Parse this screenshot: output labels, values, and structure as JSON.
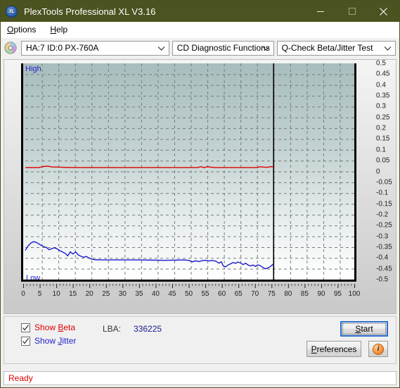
{
  "window": {
    "title": "PlexTools Professional XL V3.16",
    "icon": "xl-app-icon",
    "minimize": "minimize-icon",
    "maximize": "maximize-icon",
    "close": "close-icon"
  },
  "menu": {
    "items": [
      {
        "label": "Options",
        "accel": "O"
      },
      {
        "label": "Help",
        "accel": "H"
      }
    ]
  },
  "toolbar": {
    "drive_icon": "optical-disc-icon",
    "drive_select": {
      "value": "HA:7 ID:0  PX-760A"
    },
    "function_select": {
      "value": "CD Diagnostic Functions"
    },
    "test_select": {
      "value": "Q-Check Beta/Jitter Test"
    }
  },
  "chart_labels": {
    "high": "High",
    "low": "Low"
  },
  "controls": {
    "show_beta": {
      "label": "Show Beta",
      "checked": true,
      "color": "#e00000"
    },
    "show_jitter": {
      "label": "Show Jitter",
      "checked": true,
      "color": "#2222cc"
    },
    "lba_label": "LBA:",
    "lba_value": "336225",
    "start_label": "Start",
    "preferences_label": "Preferences",
    "info_icon": "info-icon"
  },
  "status": {
    "text": "Ready"
  },
  "colors": {
    "titlebar": "#4b5320",
    "beta_line": "#e00000",
    "jitter_line": "#1a1ad0",
    "accent_focus": "#2a6fd0"
  },
  "chart_data": {
    "type": "line",
    "title": "Q-Check Beta/Jitter Test",
    "xlabel": "",
    "ylabel": "",
    "xlim": [
      0,
      100
    ],
    "ylim": [
      -0.5,
      0.5
    ],
    "xticks": [
      0,
      5,
      10,
      15,
      20,
      25,
      30,
      35,
      40,
      45,
      50,
      55,
      60,
      65,
      70,
      75,
      80,
      85,
      90,
      95,
      100
    ],
    "yticks": [
      0.5,
      0.45,
      0.4,
      0.35,
      0.3,
      0.25,
      0.2,
      0.15,
      0.1,
      0.05,
      0,
      -0.05,
      -0.1,
      -0.15,
      -0.2,
      -0.25,
      -0.3,
      -0.35,
      -0.4,
      -0.45,
      -0.5
    ],
    "grid": true,
    "left_axis_label": "High",
    "left_axis_label_bottom": "Low",
    "scan_end_marker_x": 75,
    "series": [
      {
        "name": "Beta",
        "color": "#e00000",
        "x": [
          0,
          2,
          4,
          5,
          6,
          7,
          8,
          10,
          12,
          15,
          18,
          20,
          24,
          28,
          32,
          36,
          40,
          44,
          48,
          50,
          52,
          53,
          54,
          55,
          56,
          57,
          58,
          60,
          62,
          64,
          66,
          68,
          70,
          71,
          72,
          73,
          74,
          75
        ],
        "y": [
          0.018,
          0.018,
          0.018,
          0.021,
          0.024,
          0.024,
          0.021,
          0.02,
          0.019,
          0.018,
          0.018,
          0.018,
          0.018,
          0.018,
          0.018,
          0.018,
          0.018,
          0.018,
          0.018,
          0.018,
          0.018,
          0.022,
          0.018,
          0.022,
          0.02,
          0.018,
          0.018,
          0.018,
          0.018,
          0.018,
          0.018,
          0.018,
          0.018,
          0.022,
          0.02,
          0.019,
          0.022,
          0.022
        ]
      },
      {
        "name": "Jitter",
        "color": "#1a1ad0",
        "x": [
          0,
          0.8,
          1.6,
          2.4,
          3.2,
          4.0,
          4.8,
          5.6,
          6.4,
          7.2,
          8.0,
          8.8,
          9.6,
          10.4,
          11.2,
          12.0,
          12.8,
          13.6,
          14.4,
          15.2,
          16.0,
          16.8,
          17.6,
          18.4,
          19.2,
          20.0,
          21,
          23,
          26,
          30,
          34,
          38,
          42,
          46,
          48,
          49.5,
          50.5,
          51.5,
          52.5,
          53.5,
          54.5,
          55.5,
          56.5,
          57.5,
          58.5,
          59.2,
          59.8,
          60.5,
          61.2,
          62.0,
          62.8,
          63.5,
          64.2,
          65.0,
          65.8,
          66.5,
          67.2,
          68.0,
          68.8,
          69.5,
          70.2,
          71.0,
          71.8,
          72.5,
          73.2,
          74.0,
          74.6,
          75
        ],
        "y": [
          -0.365,
          -0.345,
          -0.332,
          -0.325,
          -0.327,
          -0.334,
          -0.342,
          -0.348,
          -0.352,
          -0.362,
          -0.357,
          -0.353,
          -0.358,
          -0.366,
          -0.372,
          -0.378,
          -0.39,
          -0.372,
          -0.382,
          -0.372,
          -0.386,
          -0.392,
          -0.397,
          -0.393,
          -0.4,
          -0.405,
          -0.408,
          -0.409,
          -0.409,
          -0.409,
          -0.409,
          -0.41,
          -0.411,
          -0.41,
          -0.409,
          -0.412,
          -0.418,
          -0.413,
          -0.417,
          -0.412,
          -0.411,
          -0.414,
          -0.412,
          -0.415,
          -0.424,
          -0.418,
          -0.437,
          -0.441,
          -0.433,
          -0.427,
          -0.421,
          -0.425,
          -0.419,
          -0.423,
          -0.431,
          -0.424,
          -0.432,
          -0.437,
          -0.433,
          -0.439,
          -0.432,
          -0.436,
          -0.444,
          -0.45,
          -0.447,
          -0.44,
          -0.432,
          -0.428
        ]
      }
    ]
  }
}
